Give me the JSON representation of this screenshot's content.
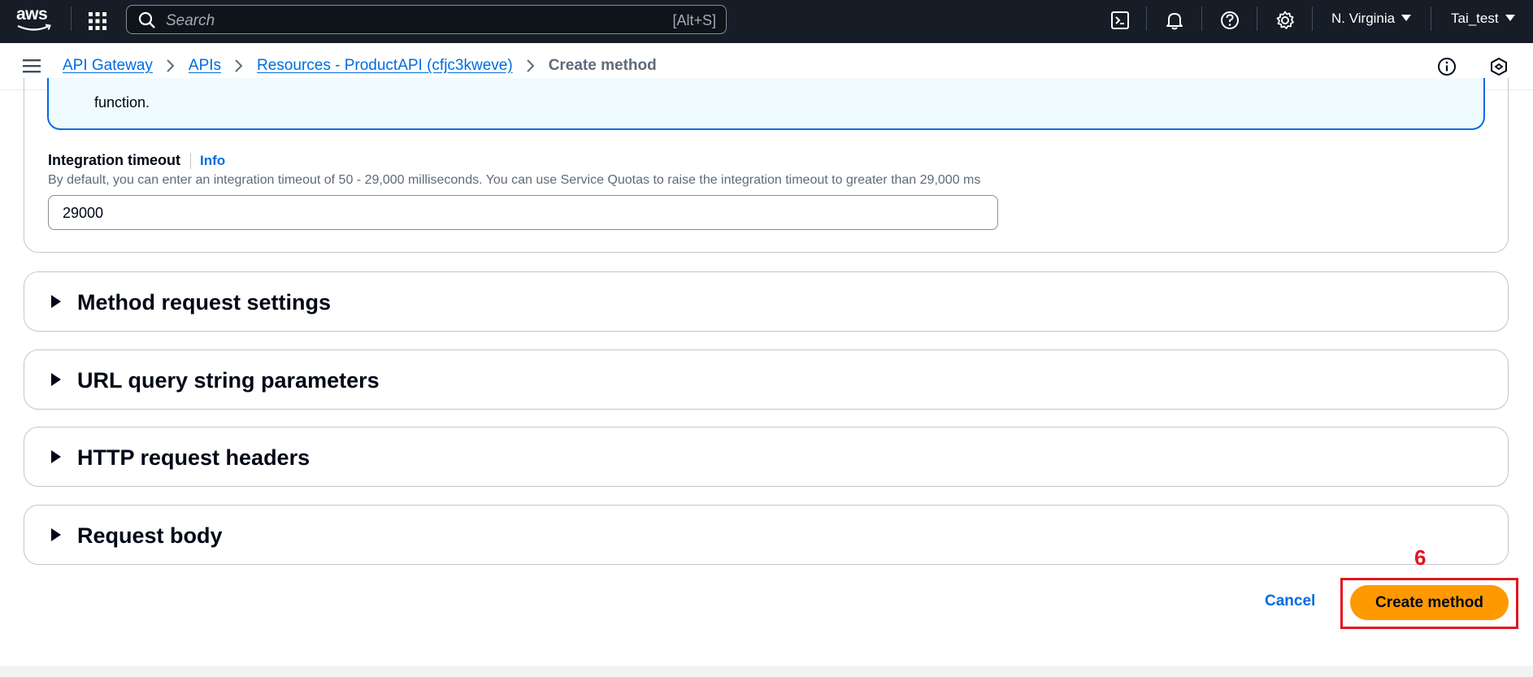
{
  "topnav": {
    "logo_text": "aws",
    "search_placeholder": "Search",
    "search_shortcut": "[Alt+S]",
    "region": "N. Virginia",
    "account": "Tai_test"
  },
  "breadcrumb": {
    "items": [
      "API Gateway",
      "APIs",
      "Resources - ProductAPI (cfjc3kweve)"
    ],
    "current": "Create method"
  },
  "alert": {
    "text_tail": "function."
  },
  "integration_timeout": {
    "label": "Integration timeout",
    "info_link": "Info",
    "description": "By default, you can enter an integration timeout of 50 - 29,000 milliseconds. You can use Service Quotas to raise the integration timeout to greater than 29,000 ms",
    "value": "29000"
  },
  "sections": [
    {
      "title": "Method request settings"
    },
    {
      "title": "URL query string parameters"
    },
    {
      "title": "HTTP request headers"
    },
    {
      "title": "Request body"
    }
  ],
  "actions": {
    "cancel": "Cancel",
    "create": "Create method"
  },
  "annotation": {
    "step_number": "6"
  },
  "colors": {
    "nav_bg": "#161d26",
    "link": "#006ce0",
    "primary": "#ff9900",
    "annotation": "#e3151f"
  }
}
